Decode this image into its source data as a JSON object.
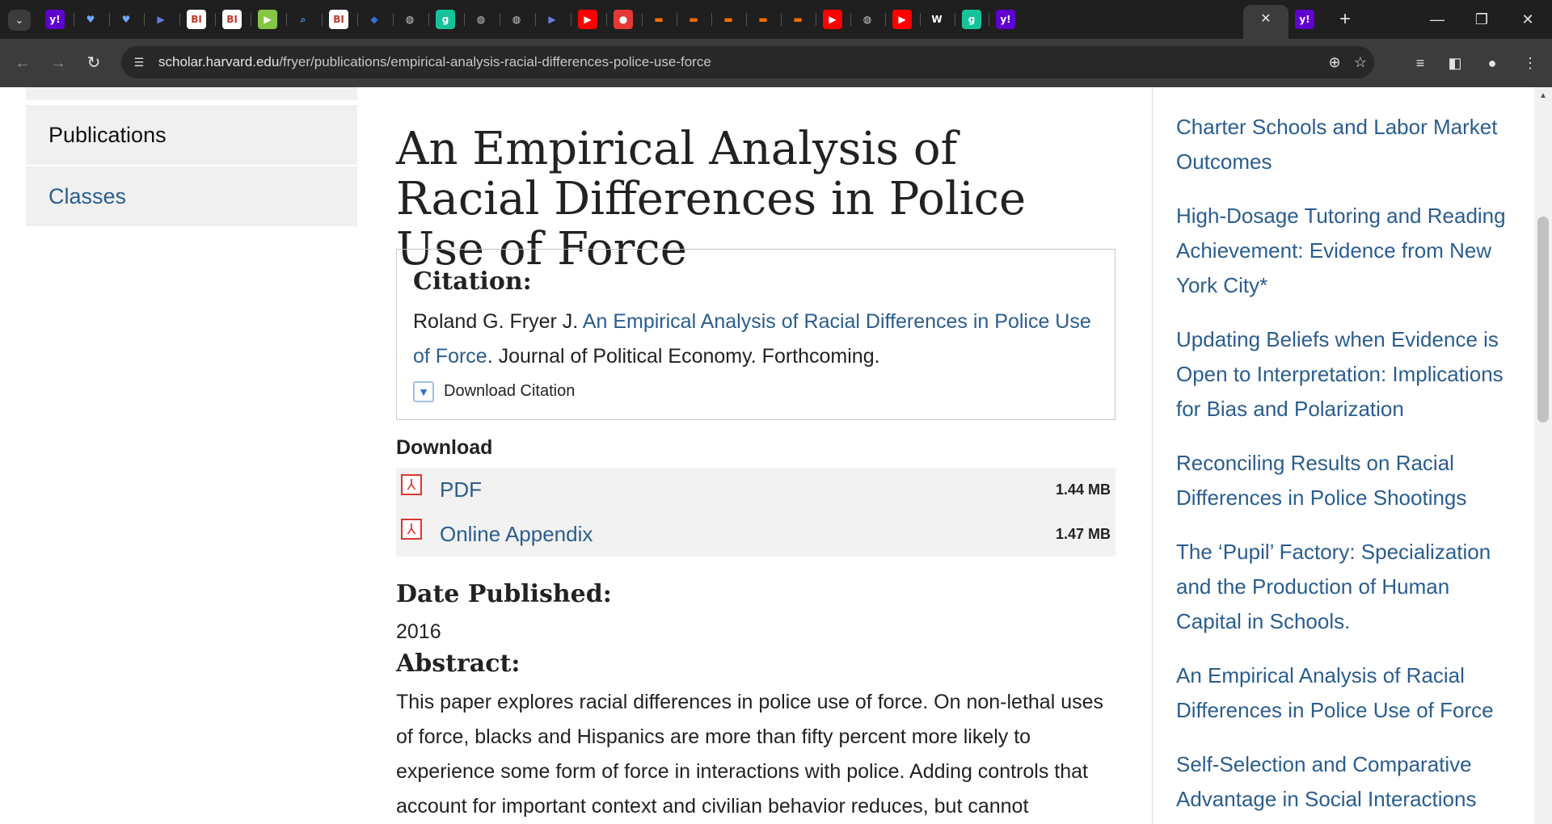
{
  "browser": {
    "tabs": [
      {
        "name": "yahoo-tab",
        "glyph": "y!",
        "bg": "#5f01d1"
      },
      {
        "name": "shield-tab",
        "glyph": "♥",
        "bg": "#1f1f1f",
        "fg": "#6aa8ff"
      },
      {
        "name": "shield-tab",
        "glyph": "♥",
        "bg": "#1f1f1f",
        "fg": "#6aa8ff"
      },
      {
        "name": "arrow-tab",
        "glyph": "▶",
        "bg": "#1f1f1f",
        "fg": "#6b7bdc"
      },
      {
        "name": "business-insider-tab",
        "glyph": "BI",
        "bg": "#ffffff",
        "fg": "#c0392b"
      },
      {
        "name": "business-insider-tab",
        "glyph": "BI",
        "bg": "#ffffff",
        "fg": "#c0392b"
      },
      {
        "name": "rumble-tab",
        "glyph": "▶",
        "bg": "#85c742"
      },
      {
        "name": "search-tab",
        "glyph": "⌕",
        "bg": "#1f1f1f",
        "fg": "#4a90e2"
      },
      {
        "name": "business-insider-tab",
        "glyph": "BI",
        "bg": "#ffffff",
        "fg": "#c0392b"
      },
      {
        "name": "cube-tab",
        "glyph": "◆",
        "bg": "#1f1f1f",
        "fg": "#3a6fd8"
      },
      {
        "name": "globe-tab",
        "glyph": "◍",
        "bg": "#1f1f1f",
        "fg": "#cfcfcf"
      },
      {
        "name": "grammarly-tab",
        "glyph": "g",
        "bg": "#15c39a"
      },
      {
        "name": "globe-tab",
        "glyph": "◍",
        "bg": "#1f1f1f",
        "fg": "#cfcfcf"
      },
      {
        "name": "globe-tab",
        "glyph": "◍",
        "bg": "#1f1f1f",
        "fg": "#cfcfcf"
      },
      {
        "name": "arrow-tab",
        "glyph": "▶",
        "bg": "#1f1f1f",
        "fg": "#6b7bdc"
      },
      {
        "name": "youtube-tab",
        "glyph": "▶",
        "bg": "#ff0000"
      },
      {
        "name": "podcast-tab",
        "glyph": "●",
        "bg": "#e53935"
      },
      {
        "name": "bookmark-tab",
        "glyph": "▬",
        "bg": "#1f1f1f",
        "fg": "#ff6d00"
      },
      {
        "name": "bookmark-tab",
        "glyph": "▬",
        "bg": "#1f1f1f",
        "fg": "#ff6d00"
      },
      {
        "name": "bookmark-tab",
        "glyph": "▬",
        "bg": "#1f1f1f",
        "fg": "#ff6d00"
      },
      {
        "name": "bookmark-tab",
        "glyph": "▬",
        "bg": "#1f1f1f",
        "fg": "#ff6d00"
      },
      {
        "name": "bookmark-tab",
        "glyph": "▬",
        "bg": "#1f1f1f",
        "fg": "#ff6d00"
      },
      {
        "name": "youtube-tab",
        "glyph": "▶",
        "bg": "#ff0000"
      },
      {
        "name": "globe-tab",
        "glyph": "◍",
        "bg": "#1f1f1f",
        "fg": "#cfcfcf"
      },
      {
        "name": "youtube-tab",
        "glyph": "▶",
        "bg": "#ff0000"
      },
      {
        "name": "wsj-tab",
        "glyph": "W",
        "bg": "#1f1f1f",
        "fg": "#ffffff"
      },
      {
        "name": "grammarly-tab",
        "glyph": "g",
        "bg": "#15c39a"
      },
      {
        "name": "yahoo-tab",
        "glyph": "y!",
        "bg": "#5f01d1"
      }
    ],
    "active_tab_close": "✕",
    "trailing_tab": {
      "name": "yahoo-tab",
      "glyph": "y!",
      "bg": "#5f01d1"
    },
    "new_tab": "+",
    "url_host": "scholar.harvard.edu",
    "url_path": "/fryer/publications/empirical-analysis-racial-differences-police-use-force"
  },
  "sidebar": {
    "current": "Publications",
    "link": "Classes"
  },
  "article": {
    "title": "An Empirical Analysis of Racial Differences in Police Use of Force",
    "citation_label": "Citation:",
    "citation_author": "Roland G. Fryer J. ",
    "citation_link": "An Empirical Analysis of Racial Differences in Police Use of Force",
    "citation_rest": ". Journal of Political Economy. Forthcoming.",
    "download_citation": "Download Citation",
    "download_heading": "Download",
    "downloads": [
      {
        "label": "PDF",
        "size": "1.44 MB"
      },
      {
        "label": "Online Appendix",
        "size": "1.47 MB"
      }
    ],
    "date_label": "Date Published:",
    "date_value": "2016",
    "abstract_label": "Abstract:",
    "abstract_text": "This paper explores racial differences in police use of force. On non-lethal uses of force, blacks and Hispanics are more than fifty percent more likely to experience some form of force in interactions with police. Adding controls that account for important context and civilian behavior reduces, but cannot"
  },
  "related": [
    "Charter Schools and Labor Market Outcomes",
    "High-Dosage Tutoring and Reading Achievement: Evidence from New York City*",
    "Updating Beliefs when Evidence is Open to Interpretation: Implications for Bias and Polarization",
    "Reconciling Results on Racial Differences in Police Shootings",
    "The ‘Pupil’ Factory: Specialization and the Production of Human Capital in Schools.",
    "An Empirical Analysis of Racial Differences in Police Use of Force",
    "Self-Selection and Comparative Advantage in Social Interactions"
  ],
  "colors": {
    "link": "#2a5d8f",
    "chrome_dark": "#1f1f1f",
    "toolbar": "#3c3c3c",
    "pdf_red": "#d9382c"
  }
}
